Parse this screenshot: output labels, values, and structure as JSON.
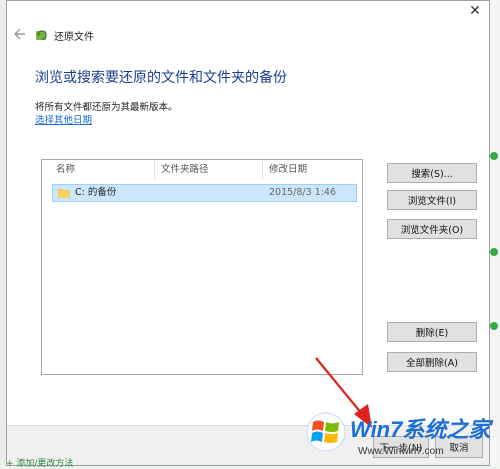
{
  "window": {
    "title": "还原文件",
    "close_glyph": "✕"
  },
  "page": {
    "heading": "浏览或搜索要还原的文件和文件夹的备份",
    "description": "将所有文件都还原为其最新版本。",
    "choose_date_link": "选择其他日期"
  },
  "list": {
    "columns": [
      "名称",
      "文件夹路径",
      "修改日期"
    ],
    "rows": [
      {
        "name": "C: 的备份",
        "path": "",
        "modified": "2015/8/3 1:46"
      }
    ]
  },
  "buttons": {
    "search": "搜索(S)...",
    "browse_files": "浏览文件(I)",
    "browse_folders": "浏览文件夹(O)",
    "remove": "删除(E)",
    "remove_all": "全部删除(A)",
    "next": "下一步(N)",
    "cancel": "取消"
  },
  "watermark": {
    "brand": "Win7系统之家",
    "url": "Www.Winwin7.com"
  },
  "background": {
    "bottom_partial_text": "+ 添加/更改方法"
  },
  "colors": {
    "heading": "#1a3d8f",
    "link": "#1a6fd1",
    "selection": "#cce6fb",
    "annotation_arrow": "#e0201c"
  },
  "icons": {
    "back": "back-arrow-icon",
    "app": "restore-files-icon",
    "folder": "folder-icon",
    "close": "close-icon"
  }
}
